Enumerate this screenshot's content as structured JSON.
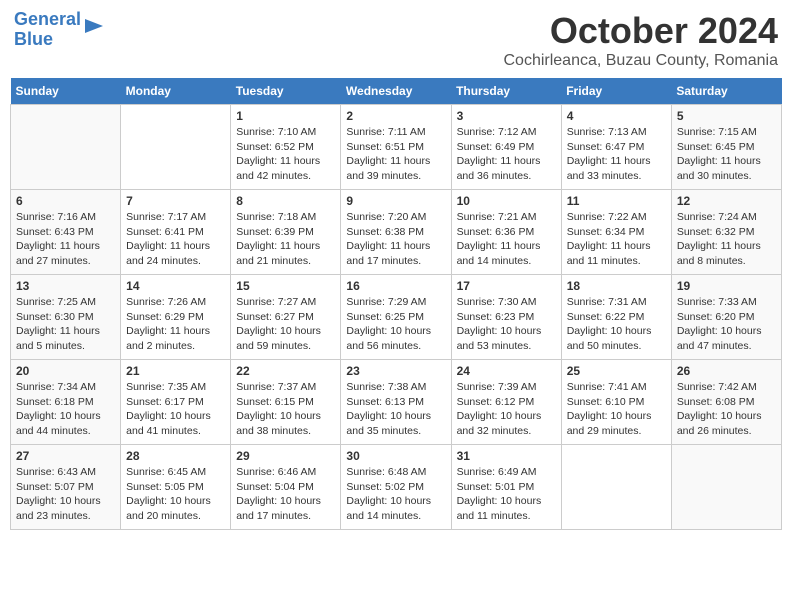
{
  "header": {
    "logo_line1": "General",
    "logo_line2": "Blue",
    "month": "October 2024",
    "location": "Cochirleanca, Buzau County, Romania"
  },
  "days_of_week": [
    "Sunday",
    "Monday",
    "Tuesday",
    "Wednesday",
    "Thursday",
    "Friday",
    "Saturday"
  ],
  "weeks": [
    [
      {
        "day": "",
        "info": ""
      },
      {
        "day": "",
        "info": ""
      },
      {
        "day": "1",
        "info": "Sunrise: 7:10 AM\nSunset: 6:52 PM\nDaylight: 11 hours and 42 minutes."
      },
      {
        "day": "2",
        "info": "Sunrise: 7:11 AM\nSunset: 6:51 PM\nDaylight: 11 hours and 39 minutes."
      },
      {
        "day": "3",
        "info": "Sunrise: 7:12 AM\nSunset: 6:49 PM\nDaylight: 11 hours and 36 minutes."
      },
      {
        "day": "4",
        "info": "Sunrise: 7:13 AM\nSunset: 6:47 PM\nDaylight: 11 hours and 33 minutes."
      },
      {
        "day": "5",
        "info": "Sunrise: 7:15 AM\nSunset: 6:45 PM\nDaylight: 11 hours and 30 minutes."
      }
    ],
    [
      {
        "day": "6",
        "info": "Sunrise: 7:16 AM\nSunset: 6:43 PM\nDaylight: 11 hours and 27 minutes."
      },
      {
        "day": "7",
        "info": "Sunrise: 7:17 AM\nSunset: 6:41 PM\nDaylight: 11 hours and 24 minutes."
      },
      {
        "day": "8",
        "info": "Sunrise: 7:18 AM\nSunset: 6:39 PM\nDaylight: 11 hours and 21 minutes."
      },
      {
        "day": "9",
        "info": "Sunrise: 7:20 AM\nSunset: 6:38 PM\nDaylight: 11 hours and 17 minutes."
      },
      {
        "day": "10",
        "info": "Sunrise: 7:21 AM\nSunset: 6:36 PM\nDaylight: 11 hours and 14 minutes."
      },
      {
        "day": "11",
        "info": "Sunrise: 7:22 AM\nSunset: 6:34 PM\nDaylight: 11 hours and 11 minutes."
      },
      {
        "day": "12",
        "info": "Sunrise: 7:24 AM\nSunset: 6:32 PM\nDaylight: 11 hours and 8 minutes."
      }
    ],
    [
      {
        "day": "13",
        "info": "Sunrise: 7:25 AM\nSunset: 6:30 PM\nDaylight: 11 hours and 5 minutes."
      },
      {
        "day": "14",
        "info": "Sunrise: 7:26 AM\nSunset: 6:29 PM\nDaylight: 11 hours and 2 minutes."
      },
      {
        "day": "15",
        "info": "Sunrise: 7:27 AM\nSunset: 6:27 PM\nDaylight: 10 hours and 59 minutes."
      },
      {
        "day": "16",
        "info": "Sunrise: 7:29 AM\nSunset: 6:25 PM\nDaylight: 10 hours and 56 minutes."
      },
      {
        "day": "17",
        "info": "Sunrise: 7:30 AM\nSunset: 6:23 PM\nDaylight: 10 hours and 53 minutes."
      },
      {
        "day": "18",
        "info": "Sunrise: 7:31 AM\nSunset: 6:22 PM\nDaylight: 10 hours and 50 minutes."
      },
      {
        "day": "19",
        "info": "Sunrise: 7:33 AM\nSunset: 6:20 PM\nDaylight: 10 hours and 47 minutes."
      }
    ],
    [
      {
        "day": "20",
        "info": "Sunrise: 7:34 AM\nSunset: 6:18 PM\nDaylight: 10 hours and 44 minutes."
      },
      {
        "day": "21",
        "info": "Sunrise: 7:35 AM\nSunset: 6:17 PM\nDaylight: 10 hours and 41 minutes."
      },
      {
        "day": "22",
        "info": "Sunrise: 7:37 AM\nSunset: 6:15 PM\nDaylight: 10 hours and 38 minutes."
      },
      {
        "day": "23",
        "info": "Sunrise: 7:38 AM\nSunset: 6:13 PM\nDaylight: 10 hours and 35 minutes."
      },
      {
        "day": "24",
        "info": "Sunrise: 7:39 AM\nSunset: 6:12 PM\nDaylight: 10 hours and 32 minutes."
      },
      {
        "day": "25",
        "info": "Sunrise: 7:41 AM\nSunset: 6:10 PM\nDaylight: 10 hours and 29 minutes."
      },
      {
        "day": "26",
        "info": "Sunrise: 7:42 AM\nSunset: 6:08 PM\nDaylight: 10 hours and 26 minutes."
      }
    ],
    [
      {
        "day": "27",
        "info": "Sunrise: 6:43 AM\nSunset: 5:07 PM\nDaylight: 10 hours and 23 minutes."
      },
      {
        "day": "28",
        "info": "Sunrise: 6:45 AM\nSunset: 5:05 PM\nDaylight: 10 hours and 20 minutes."
      },
      {
        "day": "29",
        "info": "Sunrise: 6:46 AM\nSunset: 5:04 PM\nDaylight: 10 hours and 17 minutes."
      },
      {
        "day": "30",
        "info": "Sunrise: 6:48 AM\nSunset: 5:02 PM\nDaylight: 10 hours and 14 minutes."
      },
      {
        "day": "31",
        "info": "Sunrise: 6:49 AM\nSunset: 5:01 PM\nDaylight: 10 hours and 11 minutes."
      },
      {
        "day": "",
        "info": ""
      },
      {
        "day": "",
        "info": ""
      }
    ]
  ]
}
